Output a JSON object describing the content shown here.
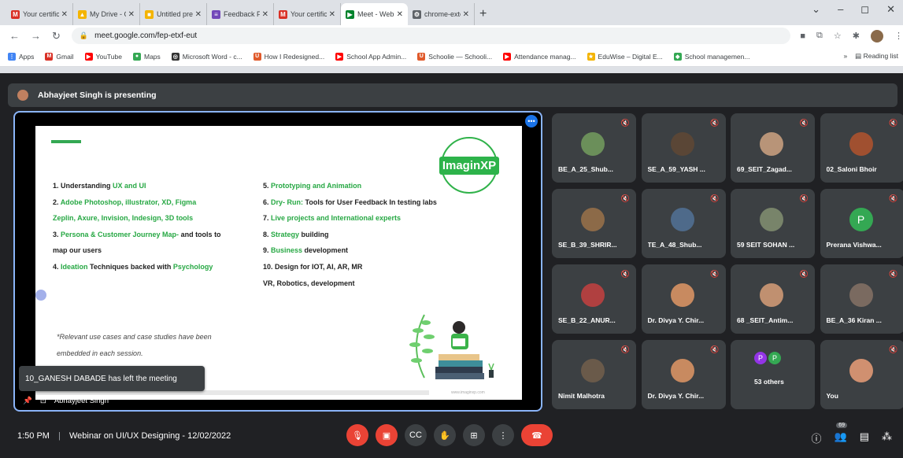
{
  "browser": {
    "tabs": [
      {
        "title": "Your certificate is here",
        "fav": "M",
        "color": "#d93025"
      },
      {
        "title": "My Drive - Google Drive",
        "fav": "▲",
        "color": "#f4b400"
      },
      {
        "title": "Untitled presentation",
        "fav": "■",
        "color": "#f4b400"
      },
      {
        "title": "Feedback Form * Web",
        "fav": "≡",
        "color": "#7248b9"
      },
      {
        "title": "Your certificate is here",
        "fav": "M",
        "color": "#d93025"
      },
      {
        "title": "Meet - Webinar",
        "fav": "▶",
        "color": "#00832d",
        "active": true
      },
      {
        "title": "chrome-extension://...",
        "fav": "⚙",
        "color": "#5f6368"
      }
    ],
    "url": "meet.google.com/fep-etxf-eut",
    "bookmarks": [
      {
        "label": "Apps",
        "color": "#4285f4",
        "glyph": "⋮"
      },
      {
        "label": "Gmail",
        "color": "#d93025",
        "glyph": "M"
      },
      {
        "label": "YouTube",
        "color": "#ff0000",
        "glyph": "▶"
      },
      {
        "label": "Maps",
        "color": "#34a853",
        "glyph": "●"
      },
      {
        "label": "Microsoft Word - c...",
        "color": "#333333",
        "glyph": "◎"
      },
      {
        "label": "How I Redesigned...",
        "color": "#e05a2b",
        "glyph": "U"
      },
      {
        "label": "School App Admin...",
        "color": "#ff0000",
        "glyph": "▶"
      },
      {
        "label": "Schoolie — Schooli...",
        "color": "#e05a2b",
        "glyph": "U"
      },
      {
        "label": "Attendance manag...",
        "color": "#ff0000",
        "glyph": "▶"
      },
      {
        "label": "EduWise – Digital E...",
        "color": "#f4b400",
        "glyph": "★"
      },
      {
        "label": "School managemen...",
        "color": "#34a853",
        "glyph": "◆"
      }
    ],
    "bookmarks_more": "»",
    "reading_list": "Reading list"
  },
  "meeting": {
    "presenter_banner": "Abhayjeet Singh is presenting",
    "presenter_name": "Abhayjeet Singh",
    "toast": "10_GANESH DABADE has left the meeting",
    "time": "1:50 PM",
    "separator": "|",
    "title": "Webinar on UI/UX Designing - 12/02/2022",
    "participant_count": "69"
  },
  "slide": {
    "logo": "ImaginXP",
    "col1": [
      [
        "1. Understanding ",
        "UX and UI",
        ""
      ],
      [
        "2. ",
        "Adobe Photoshop, illustrator, XD, Figma",
        ""
      ],
      [
        "",
        "Zeplin, Axure, Invision, Indesign, 3D tools",
        ""
      ],
      [
        "3. ",
        "Persona & Customer Journey Map-",
        " and tools to"
      ],
      [
        "map our users",
        "",
        ""
      ],
      [
        "4. ",
        "Ideation",
        " Techniques backed with "
      ],
      [
        "",
        "",
        ""
      ]
    ],
    "col1_psych": "Psychology",
    "col2": [
      [
        "5. ",
        "Prototyping and Animation",
        ""
      ],
      [
        "6. ",
        "Dry- Run:",
        " Tools for User Feedback In testing labs"
      ],
      [
        "7. ",
        "Live projects and International experts",
        ""
      ],
      [
        "8. ",
        "Strategy",
        " building"
      ],
      [
        "9. ",
        "Business",
        " development"
      ],
      [
        "10. Design for IOT, AI, AR, MR",
        "",
        ""
      ],
      [
        "VR, Robotics, development",
        "",
        ""
      ]
    ],
    "note_1": "*Relevant use cases and case studies have been",
    "note_2": "embedded in each session.",
    "footer_url": "www.imaginxp.com"
  },
  "participants": [
    {
      "name": "BE_A_25_Shub...",
      "face": "#6b8f5a",
      "col": 0,
      "row": 0
    },
    {
      "name": "SE_A_59_YASH ...",
      "face": "#5a4636",
      "col": 1,
      "row": 0
    },
    {
      "name": "69_SEIT_Zagad...",
      "face": "#b89478",
      "col": 2,
      "row": 0
    },
    {
      "name": "02_Saloni Bhoir",
      "face": "#a05030",
      "col": 3,
      "row": 0
    },
    {
      "name": "SE_B_39_SHRIR...",
      "face": "#8c6a48",
      "col": 0,
      "row": 1
    },
    {
      "name": "TE_A_48_Shub...",
      "face": "#4e6a8a",
      "col": 1,
      "row": 1
    },
    {
      "name": "59 SEIT SOHAN ...",
      "face": "#78846a",
      "col": 2,
      "row": 1
    },
    {
      "name": "Prerana Vishwa...",
      "face": "#34a853",
      "col": 3,
      "row": 1,
      "initial": "P"
    },
    {
      "name": "SE_B_22_ANUR...",
      "face": "#b04040",
      "col": 0,
      "row": 2
    },
    {
      "name": "Dr. Divya Y. Chir...",
      "face": "#c88a60",
      "col": 1,
      "row": 2
    },
    {
      "name": "68 _SEIT_Antim...",
      "face": "#c09070",
      "col": 2,
      "row": 2
    },
    {
      "name": "BE_A_36 Kiran ...",
      "face": "#7a6a60",
      "col": 3,
      "row": 2
    },
    {
      "name": "Nimit Malhotra",
      "face": "#6a5a4a",
      "col": 0,
      "row": 3
    },
    {
      "name": "Dr. Divya Y. Chir...",
      "face": "#c88a60",
      "col": 1,
      "row": 3
    },
    {
      "name": "53 others",
      "face": "#9334e6",
      "col": 2,
      "row": 3,
      "others": true
    },
    {
      "name": "You",
      "face": "#d09070",
      "col": 3,
      "row": 3
    }
  ],
  "icons": {
    "mic_off": "mic-off-icon",
    "camera_off": "camera-off-icon",
    "captions": "captions-icon",
    "raise_hand": "raise-hand-icon",
    "present": "present-icon",
    "more": "more-options-icon",
    "end_call": "end-call-icon",
    "info": "info-icon",
    "people": "people-icon",
    "chat": "chat-icon",
    "activities": "activities-icon"
  }
}
